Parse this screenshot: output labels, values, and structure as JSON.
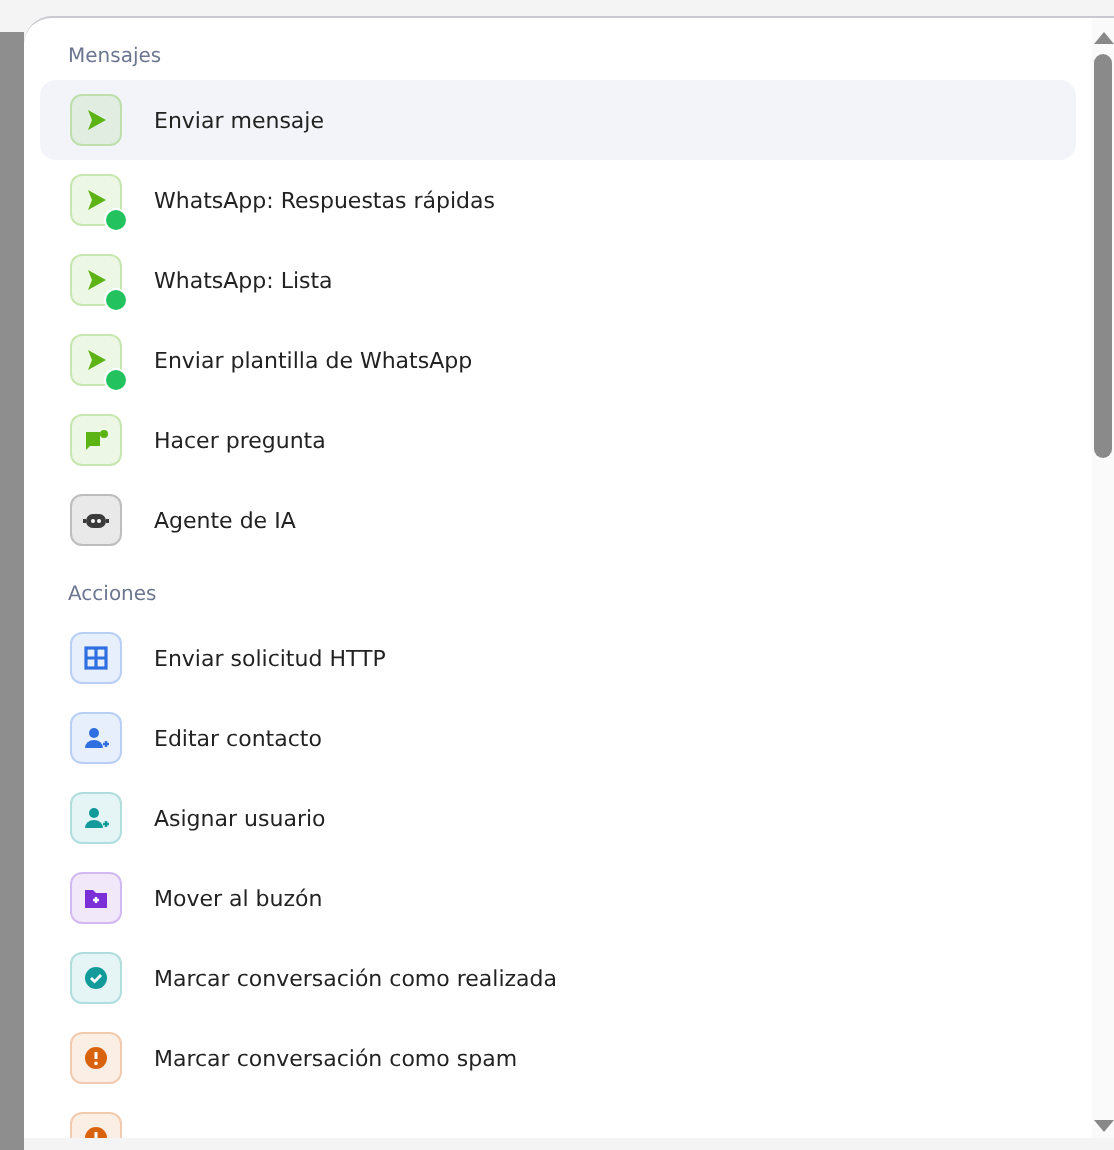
{
  "sections": [
    {
      "title": "Mensajes",
      "items": [
        {
          "label": "Enviar mensaje",
          "kind": "send",
          "color": "#5cb314",
          "selected": true
        },
        {
          "label": "WhatsApp: Respuestas rápidas",
          "kind": "send-whatsapp",
          "color": "#5cb314",
          "selected": false
        },
        {
          "label": "WhatsApp: Lista",
          "kind": "send-whatsapp",
          "color": "#5cb314",
          "selected": false
        },
        {
          "label": "Enviar plantilla de WhatsApp",
          "kind": "send-whatsapp",
          "color": "#5cb314",
          "selected": false
        },
        {
          "label": "Hacer pregunta",
          "kind": "chat",
          "color": "#5cb314",
          "selected": false
        },
        {
          "label": "Agente de IA",
          "kind": "robot",
          "color": "#3a3a3a",
          "selected": false
        }
      ]
    },
    {
      "title": "Acciones",
      "items": [
        {
          "label": "Enviar solicitud HTTP",
          "kind": "network",
          "color": "#2f6fe0",
          "selected": false
        },
        {
          "label": "Editar contacto",
          "kind": "person",
          "color": "#2f6fe0",
          "selected": false
        },
        {
          "label": "Asignar usuario",
          "kind": "person",
          "color": "#139a9a",
          "selected": false
        },
        {
          "label": "Mover al buzón",
          "kind": "folder",
          "color": "#7b2fd6",
          "selected": false
        },
        {
          "label": "Marcar conversación como realizada",
          "kind": "check",
          "color": "#139a9a",
          "selected": false
        },
        {
          "label": "Marcar conversación como spam",
          "kind": "alert",
          "color": "#d9620f",
          "selected": false
        },
        {
          "kind": "alert",
          "color": "#d9620f",
          "selected": false
        }
      ]
    }
  ]
}
